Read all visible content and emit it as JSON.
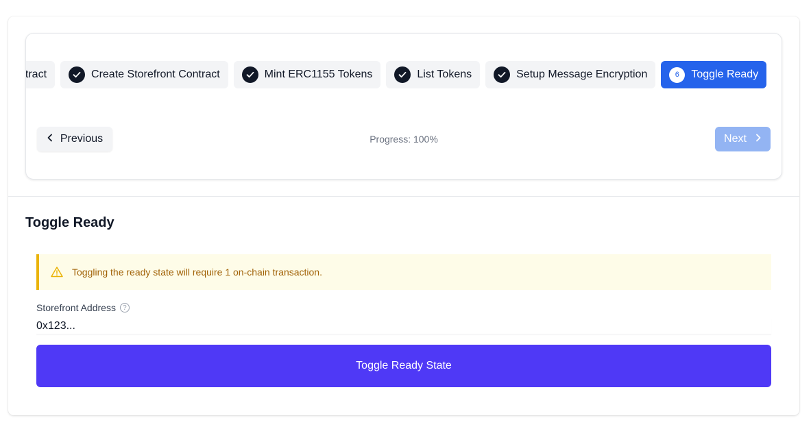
{
  "stepper": {
    "steps": [
      {
        "label": "Deploy Contract",
        "state": "done"
      },
      {
        "label": "Create Storefront Contract",
        "state": "done"
      },
      {
        "label": "Mint ERC1155 Tokens",
        "state": "done"
      },
      {
        "label": "List Tokens",
        "state": "done"
      },
      {
        "label": "Setup Message Encryption",
        "state": "done"
      },
      {
        "label": "Toggle Ready",
        "state": "active",
        "number": "6"
      }
    ],
    "first_step_visible_fragment": "ntract",
    "previous_label": "Previous",
    "next_label": "Next",
    "progress_text": "Progress: 100%"
  },
  "section": {
    "title": "Toggle Ready",
    "alert_text": "Toggling the ready state will require 1 on-chain transaction.",
    "address_label": "Storefront Address",
    "address_value": "0x123...",
    "submit_label": "Toggle Ready State"
  },
  "colors": {
    "active_step": "#2563eb",
    "next_disabled": "#93b4f3",
    "alert_bg": "#fefce8",
    "alert_border": "#eab308",
    "primary_button": "#4f39f6"
  },
  "icons": {
    "done": "check-icon",
    "prev": "chevron-left-icon",
    "next": "chevron-right-icon",
    "alert": "warning-triangle-icon",
    "help": "question-circle-icon"
  }
}
